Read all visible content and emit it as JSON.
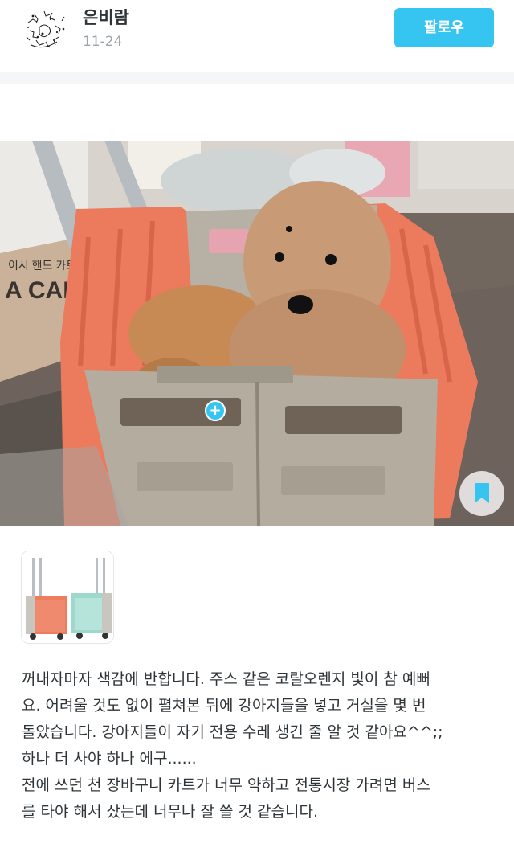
{
  "author": {
    "name": "은비람",
    "date": "11-24",
    "avatar_icon": "sketch-avatar"
  },
  "follow_button": {
    "label": "팔로우"
  },
  "photo": {
    "description_icon": "dogs-in-cart-photo",
    "tag_icon": "plus-icon",
    "tag_symbol": "+",
    "bookmark_icon": "bookmark-icon"
  },
  "product": {
    "icon": "folding-cart-product"
  },
  "post": {
    "lines": [
      "꺼내자마자 색감에 반합니다. 주스 같은 코랄오렌지 빛이 참 예뻐",
      "요. 어려울 것도 없이 펼쳐본 뒤에 강아지들을 넣고 거실을 몇 번",
      "돌았습니다. 강아지들이 자기 전용 수레 생긴 줄 알 것 같아요^^;;",
      "하나 더 사야 하나 에구......",
      "전에 쓰던 천 장바구니 카트가 너무 약하고 전통시장 가려면 버스",
      "를 타야 해서 샀는데 너무나 잘 쓸 것 같습니다."
    ]
  },
  "colors": {
    "accent": "#35c5f0",
    "cart_orange": "#f07a5c",
    "cart_gray": "#b8b3a6",
    "cart_mint": "#a8ded3"
  }
}
